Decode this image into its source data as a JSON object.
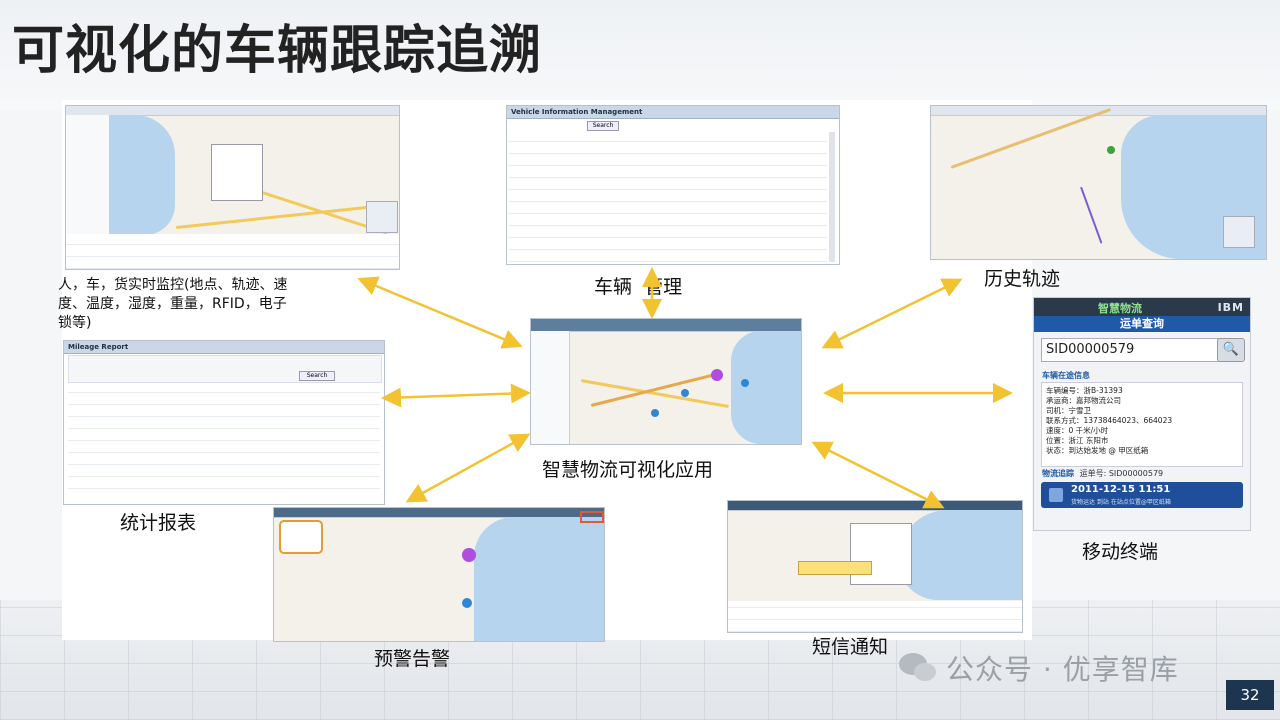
{
  "title": "可视化的车辆跟踪追溯",
  "captions": {
    "realtime_monitor": [
      "人，车，货实时监控(地点、轨迹、速",
      "度、温度，湿度，重量，RFID，电子",
      "锁等)"
    ],
    "vehicle_mgmt": "车辆  管理",
    "history_track": "历史轨迹",
    "center_app": "智慧物流可视化应用",
    "statistics": "统计报表",
    "mobile_terminal": "移动终端",
    "early_warning": "预警告警",
    "sms_notice": "短信通知"
  },
  "vehicle_window": {
    "header": "Vehicle Information Management",
    "search": "Search"
  },
  "report_window": {
    "header": "Mileage Report",
    "query": "Search"
  },
  "mobile": {
    "brand": "智慧物流",
    "ibm": "IBM",
    "bar": "运单查询",
    "search_value": "SID00000579",
    "search_icon": "🔍",
    "section": "车辆在途信息",
    "rows": [
      "车辆编号：浙B-31393",
      "承运商：嘉邦物流公司",
      "司机：宁雪卫",
      "联系方式：13738464023、664023",
      "速度：0 千米/小时",
      "位置：浙江 东阳市",
      "状态：到达始发地 @ 甲区纸箱"
    ],
    "track_label": "物流追踪",
    "track_no": "运单号: SID00000579",
    "event_time": "2011-12-15 11:51",
    "event_desc": "货物运达 到站 在站点位置@甲区纸箱"
  },
  "watermark": "公众号 · 优享智库",
  "page_number": "32",
  "colors": {
    "arrow": "#f2c230",
    "brand_blue": "#1f5aa8",
    "page_badge": "#1e3550"
  }
}
